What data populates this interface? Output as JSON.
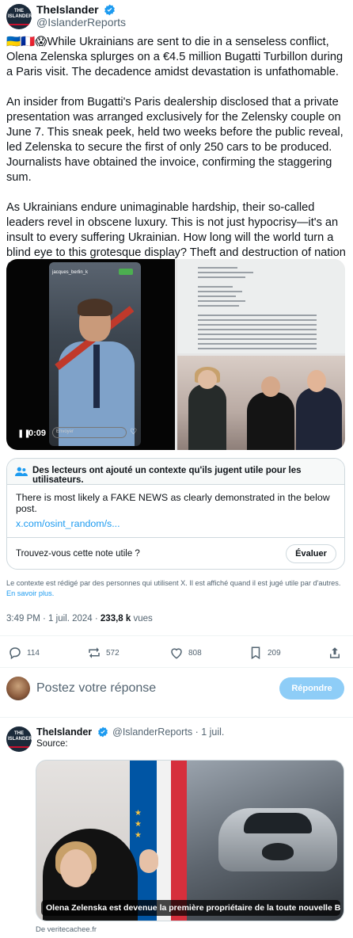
{
  "tweet": {
    "author_name": "TheIslander",
    "author_handle": "@IslanderReports",
    "avatar_text": "THE ISLANDER",
    "text": "🇺🇦🇫🇷😱While Ukrainians are sent to die in a senseless conflict, Olena Zelenska splurges on a €4.5 million Bugatti Turbillon during a Paris visit. The decadence amidst devastation is unfathomable.\n\nAn insider from Bugatti's Paris dealership disclosed that a private presentation was arranged exclusively for the Zelensky couple on June 7. This sneak peek, held two weeks before the public reveal, led Zelenska to secure the first of only 250 cars to be produced. Journalists have obtained the invoice, confirming the staggering sum.\n\nAs Ukrainians endure unimaginable hardship, their so-called leaders revel in obscene luxury. This is not just hypocrisy—it's an insult to every suffering Ukrainian. How long will the world turn a blind eye to this grotesque display? Theft and destruction of nation (Ukraine) all to please the globalist masters and their forever wars. Pure evil.",
    "video": {
      "time": "0:09",
      "story_user": "jacques_berlin_k",
      "caption": "Envoyer"
    },
    "timestamp": "3:49 PM · 1 juil. 2024",
    "views_count": "233,8 k",
    "views_label": "vues"
  },
  "community_note": {
    "title": "Des lecteurs ont ajouté un contexte qu'ils jugent utile pour les utilisateurs.",
    "body": "There is most likely a FAKE NEWS as clearly demonstrated in the below post.",
    "link": "x.com/osint_random/s...",
    "question": "Trouvez-vous cette note utile ?",
    "rate_button": "Évaluer",
    "footer": "Le contexte est rédigé par des personnes qui utilisent X. Il est affiché quand il est jugé utile par d'autres.",
    "learn_more": "En savoir plus."
  },
  "actions": {
    "replies": "114",
    "reposts": "572",
    "likes": "808",
    "bookmarks": "209"
  },
  "reply_box": {
    "placeholder": "Postez votre réponse",
    "button": "Répondre"
  },
  "reply_tweet": {
    "author_name": "TheIslander",
    "author_handle": "@IslanderReports",
    "date": "· 1 juil.",
    "text": "Source:",
    "card_title": "Olena Zelenska est devenue la première propriétaire de la toute nouvelle Bugat...",
    "card_domain": "De veritecachee.fr"
  },
  "colors": {
    "accent": "#1d9bf0",
    "text": "#0f1419",
    "muted": "#536471",
    "border": "#cfd9de",
    "reply_button": "#8ecdf7"
  }
}
